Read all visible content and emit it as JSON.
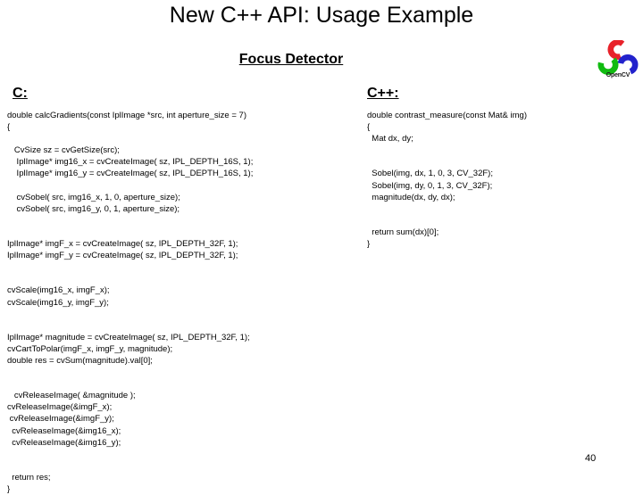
{
  "slide": {
    "title": "New C++ API: Usage Example",
    "subtitle": "Focus Detector",
    "page_number": "40",
    "colors": {
      "background": "#ffffff",
      "text": "#000000",
      "logo_red": "#e8222a",
      "logo_green": "#11bb11",
      "logo_blue": "#2222cc"
    }
  },
  "columns": {
    "c": {
      "header": "C:",
      "code_lines": [
        "double calcGradients(const IplImage *src, int aperture_size = 7)",
        "{",
        "",
        "   CvSize sz = cvGetSize(src);",
        "    IplImage* img16_x = cvCreateImage( sz, IPL_DEPTH_16S, 1);",
        "    IplImage* img16_y = cvCreateImage( sz, IPL_DEPTH_16S, 1);",
        "",
        "    cvSobel( src, img16_x, 1, 0, aperture_size);",
        "    cvSobel( src, img16_y, 0, 1, aperture_size);",
        "",
        "",
        "IplImage* imgF_x = cvCreateImage( sz, IPL_DEPTH_32F, 1);",
        "IplImage* imgF_y = cvCreateImage( sz, IPL_DEPTH_32F, 1);",
        "",
        "",
        "cvScale(img16_x, imgF_x);",
        "cvScale(img16_y, imgF_y);",
        "",
        "",
        "IplImage* magnitude = cvCreateImage( sz, IPL_DEPTH_32F, 1);",
        "cvCartToPolar(imgF_x, imgF_y, magnitude);",
        "double res = cvSum(magnitude).val[0];",
        "",
        "",
        "   cvReleaseImage( &magnitude );",
        "cvReleaseImage(&imgF_x);",
        " cvReleaseImage(&imgF_y);",
        "  cvReleaseImage(&img16_x);",
        "  cvReleaseImage(&img16_y);",
        "",
        "",
        "  return res;",
        "}"
      ]
    },
    "cpp": {
      "header": "C++:",
      "code_lines": [
        "double contrast_measure(const Mat& img)",
        "{",
        "  Mat dx, dy;",
        "",
        "",
        "  Sobel(img, dx, 1, 0, 3, CV_32F);",
        "  Sobel(img, dy, 0, 1, 3, CV_32F);",
        "  magnitude(dx, dy, dx);",
        "",
        "",
        "  return sum(dx)[0];",
        "}"
      ]
    }
  },
  "logo": {
    "name": "opencv-logo",
    "wordmark": "OpenCV"
  }
}
